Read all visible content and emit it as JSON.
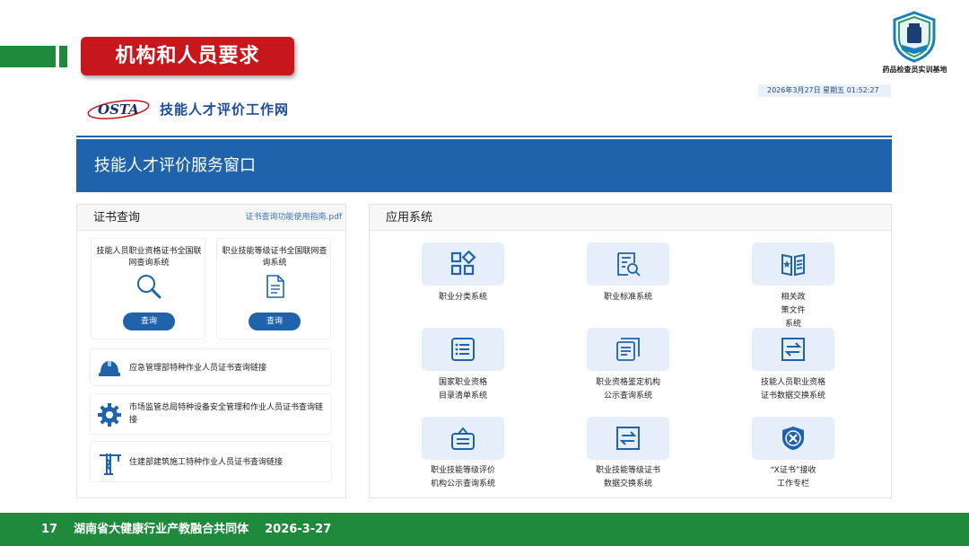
{
  "slide": {
    "title": "机构和人员要求",
    "logo_text": "药品检查员实训基地",
    "footer": {
      "page": "17",
      "org": "湖南省大健康行业产教融合共同体",
      "date": "2026-3-27"
    }
  },
  "site": {
    "logo_text": "OSTA",
    "name": "技能人才评价工作网",
    "datetime": "2026年3月27日 星期五 01:52:27",
    "banner": "技能人才评价服务窗口"
  },
  "cert_panel": {
    "title": "证书查询",
    "guide_link": "证书查询功能使用指南.pdf",
    "cards": [
      {
        "title": "技能人员职业资格证书全国联网查询系统",
        "button": "查询",
        "icon": "search-icon"
      },
      {
        "title": "职业技能等级证书全国联网查询系统",
        "button": "查询",
        "icon": "document-icon"
      }
    ],
    "links": [
      {
        "label": "应急管理部特种作业人员证书查询链接",
        "icon": "hardhat-icon"
      },
      {
        "label": "市场监管总局特种设备安全管理和作业人员证书查询链接",
        "icon": "gear-icon"
      },
      {
        "label": "住建部建筑施工特种作业人员证书查询链接",
        "icon": "crane-icon"
      }
    ]
  },
  "apps_panel": {
    "title": "应用系统",
    "apps": [
      {
        "label": "职业分类系统",
        "icon": "category-icon"
      },
      {
        "label": "职业标准系统",
        "icon": "standard-search-icon"
      },
      {
        "label": "相关政策文件系统",
        "icon": "policy-book-icon"
      },
      {
        "label": "国家职业资格目录清单系统",
        "icon": "list-icon"
      },
      {
        "label": "职业资格鉴定机构公示查询系统",
        "icon": "documents-icon"
      },
      {
        "label": "技能人员职业资格证书数据交换系统",
        "icon": "exchange-icon"
      },
      {
        "label": "职业技能等级评价机构公示查询系统",
        "icon": "sign-board-icon"
      },
      {
        "label": "职业技能等级证书数据交换系统",
        "icon": "exchange-icon"
      },
      {
        "label": "“X证书”接收工作专栏",
        "icon": "x-cert-icon"
      }
    ]
  },
  "colors": {
    "brand_blue": "#1f63ad",
    "footer_green": "#1f8a3b",
    "title_red": "#c8161d",
    "tile_bg": "#e6eff9"
  }
}
